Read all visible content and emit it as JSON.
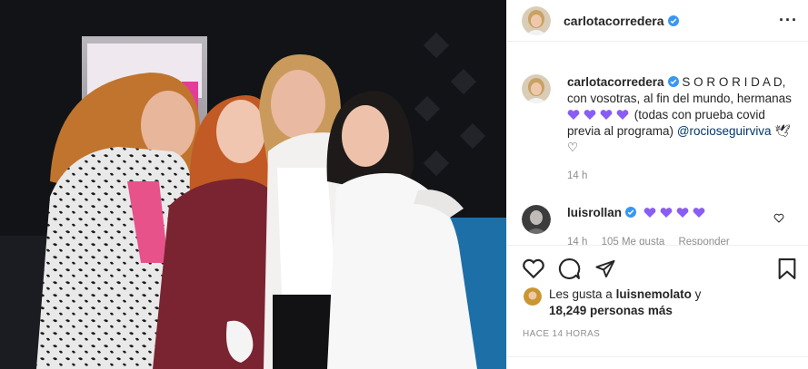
{
  "post": {
    "username": "carlotacorredera",
    "verified": true,
    "more_icon": "more-horizontal-icon"
  },
  "caption": {
    "username": "carlotacorredera",
    "text_1": "S O R O R I D A D,",
    "text_2": "con vosotras, al fin del mundo, hermanas",
    "text_3": "(todas con prueba covid previa al programa)",
    "mention": "@rocioseguirviva",
    "tail": "🕊♡",
    "time": "14 h"
  },
  "comment": {
    "username": "luisrollan",
    "time": "14 h",
    "likes": "105 Me gusta",
    "reply": "Responder"
  },
  "likes": {
    "prefix": "Les gusta a",
    "user": "luisnemolato",
    "conj": "y",
    "count": "18,249 personas más"
  },
  "timestamp": "HACE 14 HORAS",
  "colors": {
    "purple_heart": "#8a5cf6",
    "verified": "#3897f0",
    "link": "#00376b"
  }
}
